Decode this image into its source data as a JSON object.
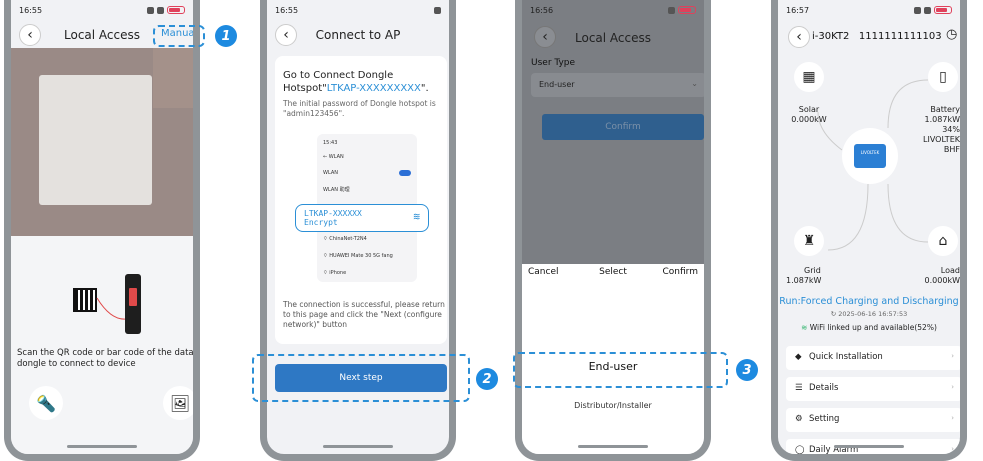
{
  "steps": [
    "1",
    "2",
    "3"
  ],
  "phone1": {
    "status_time": "16:55",
    "title": "Local Access",
    "manual_label": "Manual",
    "scan_text": "Scan the QR code or bar code of the data dongle to connect to device"
  },
  "phone2": {
    "status_time": "16:55",
    "title": "Connect to AP",
    "heading_pre": "Go to Connect Dongle Hotspot\"",
    "hotspot": "LTKAP-XXXXXXXXX",
    "heading_post": "\".",
    "password_note": "The initial password of Dongle hotspot is \"admin123456\".",
    "mini": {
      "time": "15:43",
      "wlan_header": "WLAN",
      "wlan": "WLAN",
      "wlan_cn": "WLAN 助理",
      "pill_ssid": "LTKAP-XXXXXX",
      "pill_sec": "Encrypt",
      "net1": "ChinaNet-T2N4",
      "net2": "HUAWEI Mate 30 5G fang",
      "net3": "iPhone"
    },
    "success_text": "The connection is successful, please return to this page and click the \"Next (configure network)\" button",
    "next_label": "Next step"
  },
  "phone3": {
    "status_time": "16:56",
    "title": "Local Access",
    "user_type_label": "User Type",
    "user_type_value": "End-user",
    "confirm_label": "Confirm",
    "picker_cancel": "Cancel",
    "picker_select": "Select",
    "picker_confirm": "Confirm",
    "option_selected": "End-user",
    "option_other": "Distributor/Installer"
  },
  "phone4": {
    "status_time": "16:57",
    "title_model": "i-30KT2",
    "title_sn": "1111111111103",
    "solar_label": "Solar",
    "solar_value": "0.000kW",
    "battery_label": "Battery",
    "battery_value": "1.087kW",
    "battery_soc": "34%",
    "battery_brand": "LIVOLTEK",
    "battery_model": "BHF",
    "inverter_brand": "LIVOLTEK",
    "grid_label": "Grid",
    "grid_value": "1.087kW",
    "load_label": "Load",
    "load_value": "0.000kW",
    "run_status": "Run:Forced Charging and Discharging",
    "timestamp": "2025-06-16 16:57:53",
    "wifi_status": "WiFi linked up and available(52%)",
    "menu": [
      "Quick Installation",
      "Details",
      "Setting",
      "Daily Alarm"
    ]
  },
  "colors": {
    "accent": "#2b8fd6",
    "step": "#1d8ae0",
    "button": "#2e78c4",
    "frame": "#8f9498"
  }
}
